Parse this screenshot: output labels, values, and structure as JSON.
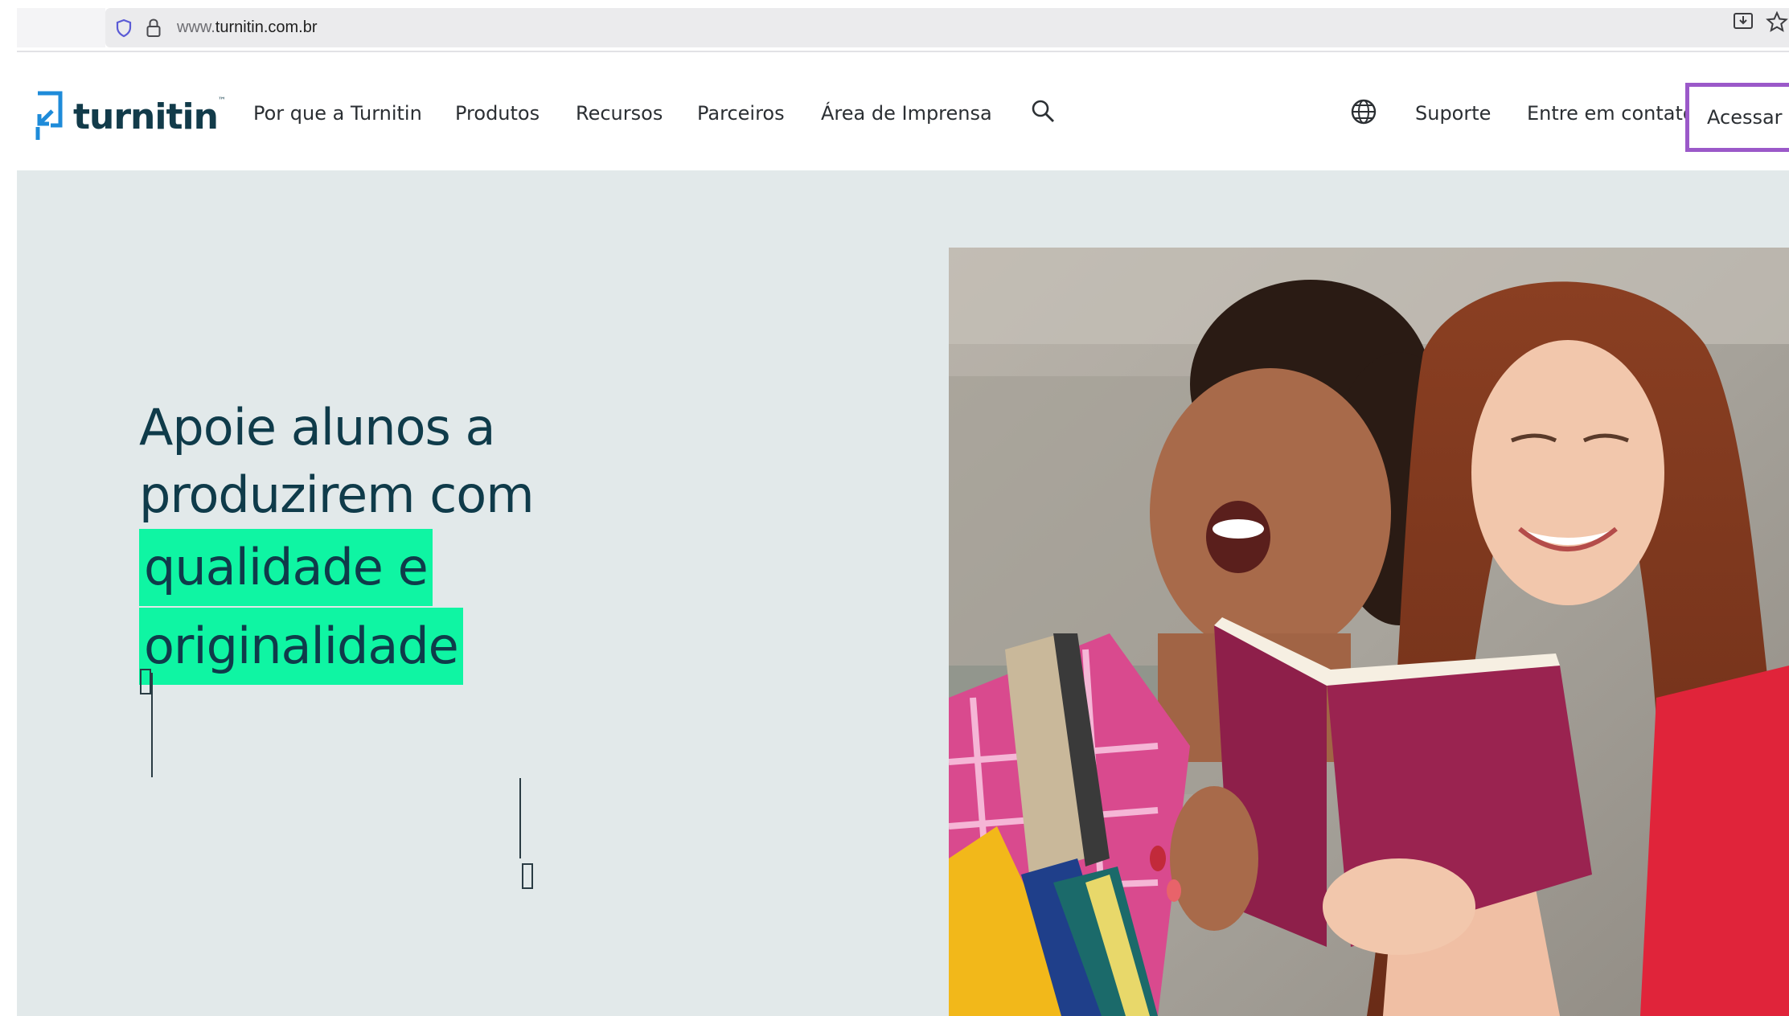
{
  "browser": {
    "url_prefix": "www.",
    "url_domain": "turnitin.com.br"
  },
  "header": {
    "logo_text": "turnitin",
    "nav": [
      {
        "label": "Por que a Turnitin"
      },
      {
        "label": "Produtos"
      },
      {
        "label": "Recursos"
      },
      {
        "label": "Parceiros"
      },
      {
        "label": "Área de Imprensa"
      }
    ],
    "right": {
      "support_label": "Suporte",
      "contact_label": "Entre em contato",
      "login_label": "Acessar"
    }
  },
  "hero": {
    "line1": "Apoie alunos a",
    "line2": "produzirem com",
    "highlight1": "qualidade e",
    "highlight2": "originalidade"
  },
  "colors": {
    "accent": "#0ff5a3",
    "brand_dark": "#123b4a",
    "logo_blue": "#1e8bd9",
    "focus_outline": "#9b59c9",
    "hero_bg": "#e2e9ea"
  }
}
